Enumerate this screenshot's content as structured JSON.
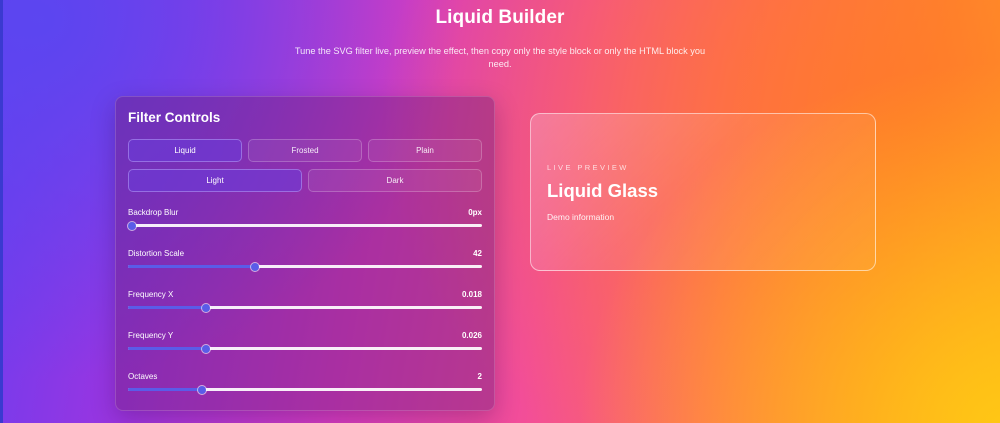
{
  "header": {
    "title": "Liquid Builder",
    "subtitle": "Tune the SVG filter live, preview the effect, then copy only the style block or only the HTML block you need."
  },
  "controls": {
    "title": "Filter Controls",
    "modes": [
      {
        "label": "Liquid",
        "active": true
      },
      {
        "label": "Frosted",
        "active": false
      },
      {
        "label": "Plain",
        "active": false
      }
    ],
    "themes": [
      {
        "label": "Light",
        "active": true
      },
      {
        "label": "Dark",
        "active": false
      }
    ],
    "sliders": [
      {
        "label": "Backdrop Blur",
        "value": "0px",
        "fill": 0.0
      },
      {
        "label": "Distortion Scale",
        "value": "42",
        "fill": 0.36
      },
      {
        "label": "Frequency X",
        "value": "0.018",
        "fill": 0.22
      },
      {
        "label": "Frequency Y",
        "value": "0.026",
        "fill": 0.22
      },
      {
        "label": "Octaves",
        "value": "2",
        "fill": 0.21
      }
    ]
  },
  "preview": {
    "kicker": "LIVE PREVIEW",
    "title": "Liquid Glass",
    "text": "Demo information"
  },
  "colors": {
    "accent": "#5a5ce8",
    "active_button": "#693cdc"
  }
}
